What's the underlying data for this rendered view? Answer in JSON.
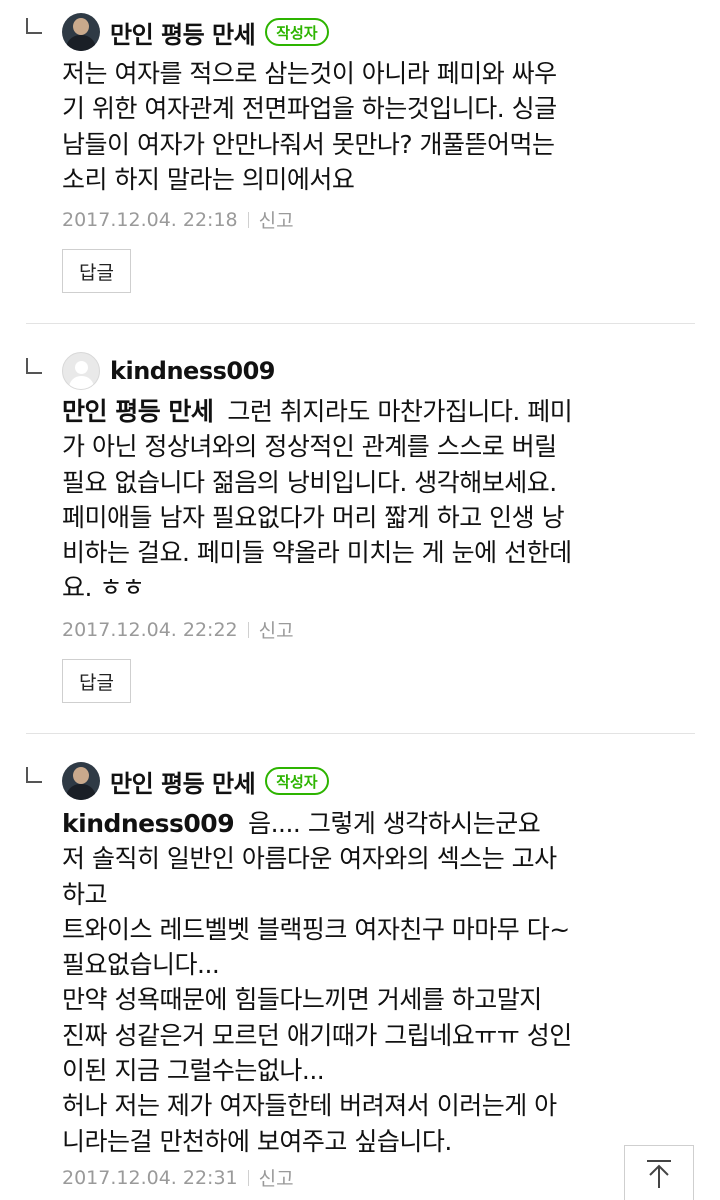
{
  "comments": [
    {
      "author": "만인 평등 만세",
      "badge": "작성자",
      "mention": "",
      "text": "저는 여자를 적으로 삼는것이 아니라 페미와 싸우\n기 위한 여자관계 전면파업을 하는것입니다. 싱글\n남들이 여자가 안만나줘서 못만나? 개풀뜯어먹는\n소리 하지 말라는 의미에서요",
      "timestamp": "2017.12.04. 22:18",
      "report_label": "신고",
      "reply_label": "답글"
    },
    {
      "author": "kindness009",
      "badge": "",
      "mention": "만인 평등 만세",
      "text": "그런 취지라도 마찬가집니다. 페미\n가 아닌 정상녀와의 정상적인 관계를 스스로 버릴\n필요 없습니다 젊음의 낭비입니다. 생각해보세요.\n페미애들 남자 필요없다가 머리 짧게 하고 인생 낭\n비하는 걸요. 페미들 약올라 미치는 게 눈에 선한데\n요. ㅎㅎ",
      "timestamp": "2017.12.04. 22:22",
      "report_label": "신고",
      "reply_label": "답글"
    },
    {
      "author": "만인 평등 만세",
      "badge": "작성자",
      "mention": "kindness009",
      "text": "음.... 그렇게 생각하시는군요\n저 솔직히 일반인 아름다운 여자와의 섹스는 고사\n하고\n트와이스 레드벨벳 블랙핑크 여자친구 마마무 다~\n필요없습니다...\n만약 성욕때문에 힘들다느끼면 거세를 하고말지\n진짜 성같은거 모르던 애기때가 그립네요ㅠㅠ 성인\n이된 지금 그럴수는없나...\n허나 저는 제가 여자들한테 버려져서 이러는게 아\n니라는걸 만천하에 보여주고 싶습니다.",
      "timestamp": "2017.12.04. 22:31",
      "report_label": "신고"
    }
  ],
  "icons": {
    "reply_indicator": "reply-arrow-icon",
    "scroll_top": "arrow-up-icon"
  },
  "colors": {
    "badge_green": "#2db400",
    "meta_gray": "#9a9a9a"
  }
}
